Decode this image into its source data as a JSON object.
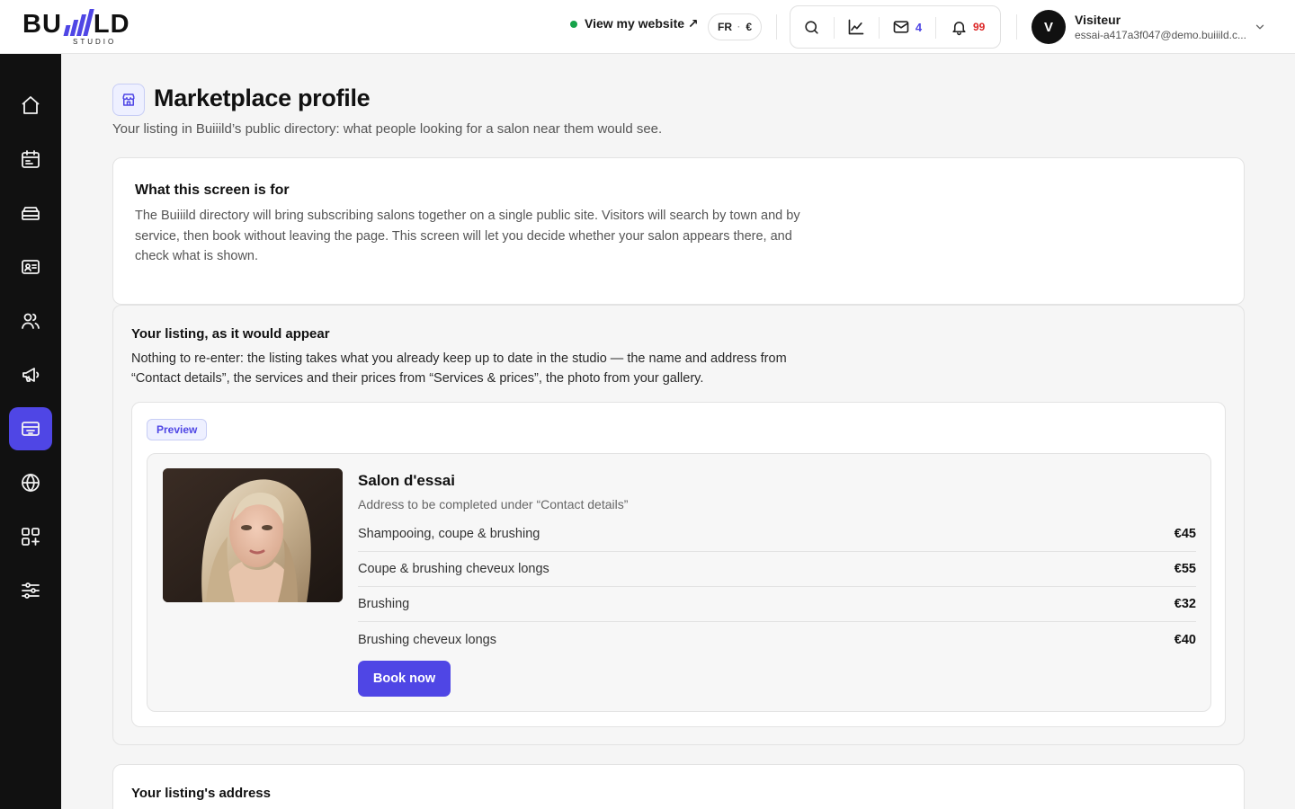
{
  "brand": {
    "logo_prefix": "BU",
    "logo_suffix": "LD",
    "logo_sub": "STUDIO"
  },
  "header": {
    "view_site_label": "View my website ↗",
    "lang": "FR",
    "lang_separator": "·",
    "currency": "€",
    "messages_count": "4",
    "notifications_count": "99",
    "user": {
      "initial": "V",
      "name": "Visiteur",
      "email": "essai-a417a3f047@demo.buiiild.c..."
    }
  },
  "sidebar": {
    "items": [
      {
        "name": "home",
        "icon": "home-icon",
        "active": false
      },
      {
        "name": "calendar",
        "icon": "calendar-icon",
        "active": false
      },
      {
        "name": "services",
        "icon": "stack-icon",
        "active": false
      },
      {
        "name": "contacts",
        "icon": "id-card-icon",
        "active": false
      },
      {
        "name": "team",
        "icon": "users-icon",
        "active": false
      },
      {
        "name": "marketing",
        "icon": "megaphone-icon",
        "active": false
      },
      {
        "name": "marketplace",
        "icon": "storefront-card-icon",
        "active": true
      },
      {
        "name": "website",
        "icon": "globe-icon",
        "active": false
      },
      {
        "name": "apps",
        "icon": "apps-plus-icon",
        "active": false
      },
      {
        "name": "settings",
        "icon": "sliders-icon",
        "active": false
      }
    ]
  },
  "page": {
    "title": "Marketplace profile",
    "subtitle": "Your listing in Buiiild’s public directory: what people looking for a salon near them would see."
  },
  "info_card": {
    "title": "What this screen is for",
    "body": "The Buiiild directory will bring subscribing salons together on a single public site. Visitors will search by town and by service, then book without leaving the page. This screen will let you decide whether your salon appears there, and check what is shown."
  },
  "listing_card": {
    "title": "Your listing, as it would appear",
    "body": "Nothing to re-enter: the listing takes what you already keep up to date in the studio — the name and address from “Contact details”, the services and their prices from “Services & prices”, the photo from your gallery.",
    "badge": "Preview",
    "salon": {
      "name": "Salon d'essai",
      "address": "Address to be completed under “Contact details”",
      "services": [
        {
          "name": "Shampooing, coupe & brushing",
          "price": "€45"
        },
        {
          "name": "Coupe & brushing cheveux longs",
          "price": "€55"
        },
        {
          "name": "Brushing",
          "price": "€32"
        },
        {
          "name": "Brushing cheveux longs",
          "price": "€40"
        }
      ],
      "book_label": "Book now"
    }
  },
  "address_card": {
    "title": "Your listing's address"
  },
  "colors": {
    "accent": "#4f46e5",
    "sidebar": "#111111",
    "online": "#16a34a",
    "alert": "#dc2626"
  }
}
